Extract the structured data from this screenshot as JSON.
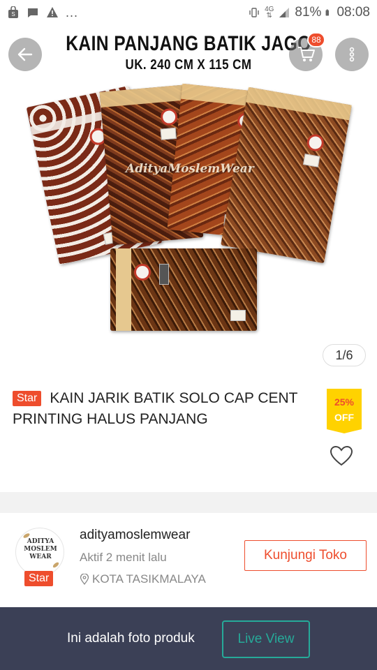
{
  "status_bar": {
    "network": "4G",
    "battery": "81%",
    "time": "08:08",
    "overflow": "..."
  },
  "header": {
    "cart_count": "88"
  },
  "product_image": {
    "title_line1": "KAIN PANJANG BATIK JAGO",
    "title_line2": "UK. 240 CM X 115 CM",
    "watermark": "AdityaMoslemWear",
    "pager": "1/6"
  },
  "product": {
    "badge": "Star",
    "name": "KAIN JARIK BATIK SOLO CAP CENT PRINTING HALUS PANJANG",
    "discount_percent": "25%",
    "discount_label": "OFF"
  },
  "seller": {
    "logo_text_1": "ADITYA",
    "logo_text_2": "MOSLEM",
    "logo_text_3": "WEAR",
    "badge": "Star",
    "name": "adityamoslemwear",
    "active": "Aktif 2 menit lalu",
    "location": "KOTA TASIKMALAYA",
    "visit_label": "Kunjungi Toko"
  },
  "bottom_bar": {
    "text": "Ini adalah foto produk",
    "live_label": "Live View"
  },
  "colors": {
    "accent": "#ee4d2d",
    "discount_bg": "#ffd200",
    "live_teal": "#26aa99",
    "bottom_bar": "#3b4056"
  }
}
